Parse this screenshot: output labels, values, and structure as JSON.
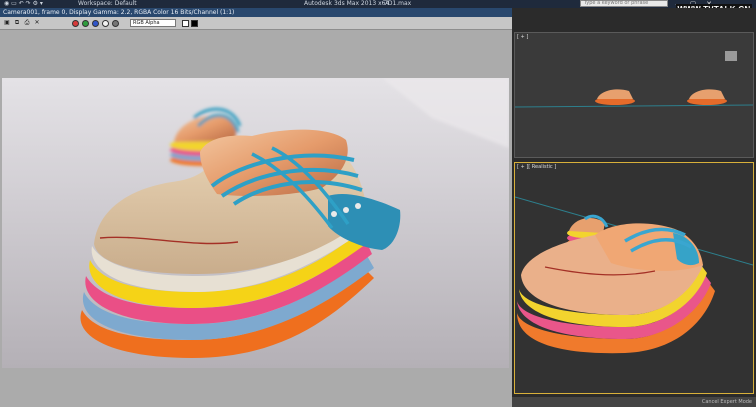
{
  "top_bar": {
    "workspace": "Workspace: Default",
    "app_title": "Autodesk 3ds Max  2013 x64",
    "file_name": "7D1.max",
    "search_placeholder": "Type a keyword or phrase"
  },
  "watermark": "WWW.TVTALK.CN",
  "frame_buffer": {
    "title": "Camera001, frame 0, Display Gamma: 2.2, RGBA Color 16 Bits/Channel (1:1)",
    "channel_select": "RGB Alpha"
  },
  "viewports": {
    "top_label": "[ + ]",
    "persp_label": "[ + ][ Realistic ]"
  },
  "status": "Cancel Expert Mode"
}
